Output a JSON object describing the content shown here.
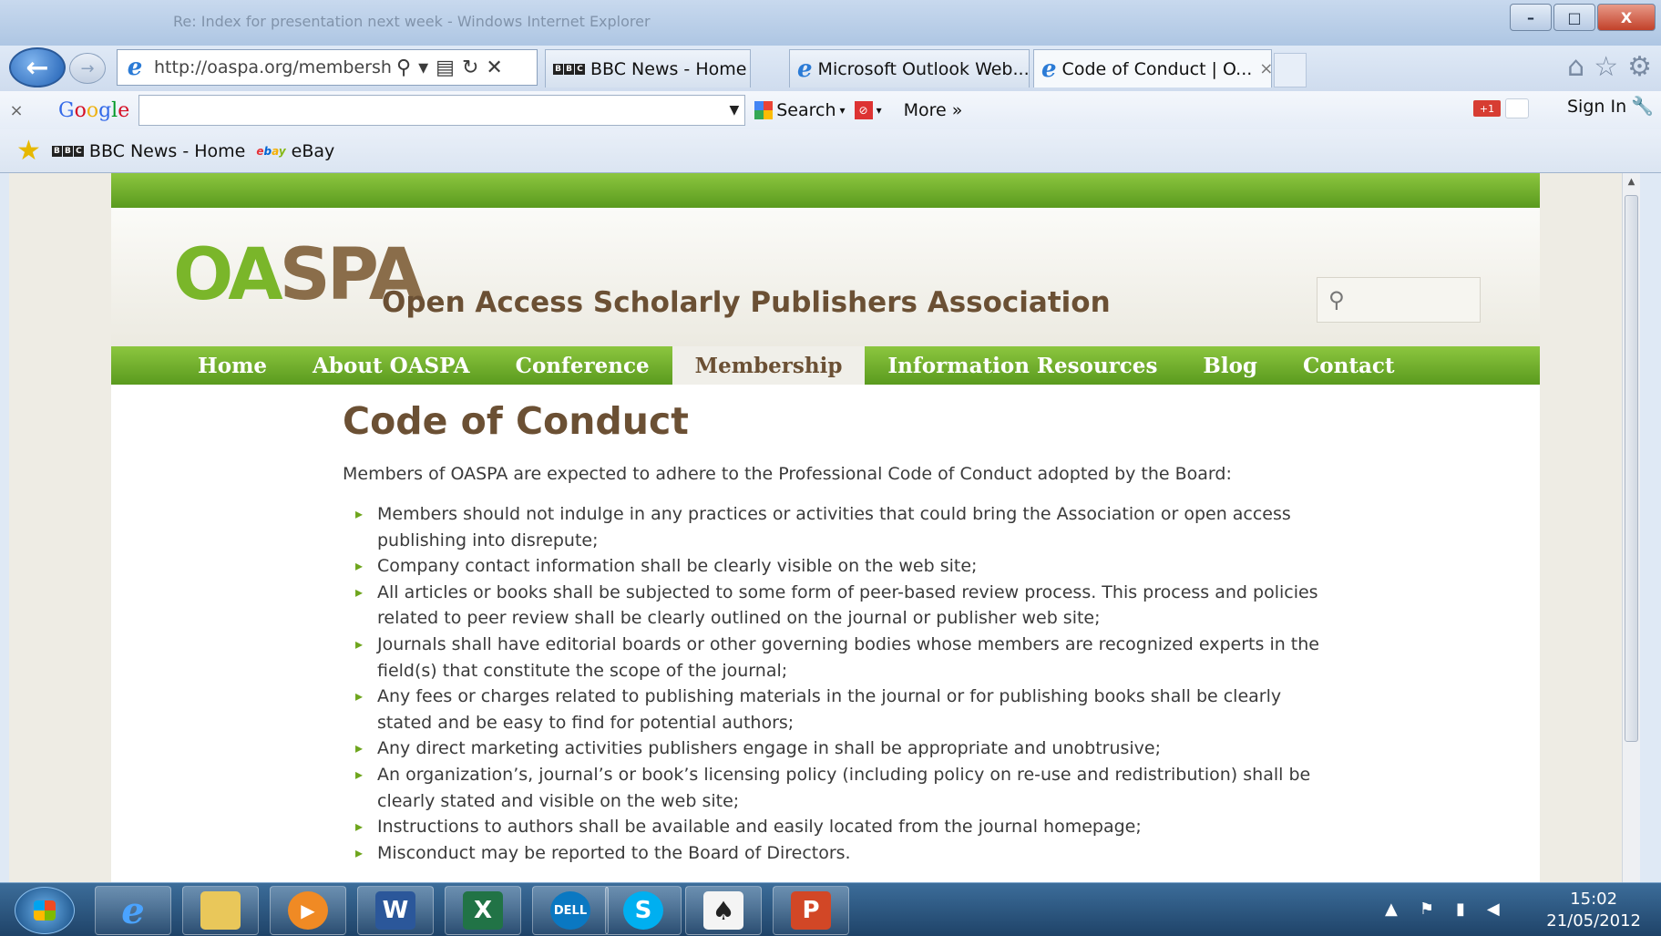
{
  "window": {
    "title": "Re: Index for presentation next week - Windows Internet Explorer",
    "minimize": "–",
    "restore": "□",
    "close": "X"
  },
  "browser": {
    "url": "http://oaspa.org/membershi",
    "tabs": [
      {
        "label": "BBC News - Home",
        "icon": "bbc-icon"
      },
      {
        "label": "Microsoft Outlook Web...",
        "icon": "ie-icon"
      },
      {
        "label": "Code of Conduct | O...",
        "icon": "ie-icon",
        "active": true
      }
    ],
    "tab_close": "×"
  },
  "googlebar": {
    "close": "×",
    "logo_letters": [
      "G",
      "o",
      "o",
      "g",
      "l",
      "e"
    ],
    "search_value": "",
    "search_label": "Search",
    "more_label": "More »",
    "gplus_label": "+1",
    "signin_label": "Sign In"
  },
  "favorites": [
    {
      "label": "BBC News - Home"
    },
    {
      "label": "eBay"
    }
  ],
  "site": {
    "logo": "OASPA",
    "title": "Open Access Scholarly Publishers Association",
    "search_placeholder": "",
    "menu": [
      "Home",
      "About OASPA",
      "Conference",
      "Membership",
      "Information Resources",
      "Blog",
      "Contact"
    ],
    "active_menu": "Membership",
    "page_title": "Code of Conduct",
    "intro": "Members of OASPA are expected to adhere to the Professional Code of Conduct adopted by the Board:",
    "bullets": [
      "Members should not indulge in any practices or activities that could bring the Association or open access publishing into disrepute;",
      "Company contact information shall be clearly visible on the web site;",
      "All articles or books shall be subjected to some form of peer-based review process. This process and policies related to peer review shall be clearly outlined on the journal or publisher web site;",
      "Journals shall have editorial boards or other governing bodies whose members are recognized experts in the field(s) that constitute the scope of the journal;",
      "Any fees or charges related to publishing materials in the journal or for publishing books shall be clearly stated and be easy to find for potential authors;",
      "Any direct marketing activities publishers engage in shall be appropriate and unobtrusive;",
      "An organization’s, journal’s or book’s licensing policy (including policy on re-use and redistribution) shall be clearly stated and visible on the web site;",
      "Instructions to authors shall be available and easily located from the journal homepage;",
      "Misconduct may be reported to the Board of Directors."
    ]
  },
  "taskbar": {
    "apps": [
      "Internet Explorer",
      "Windows Explorer",
      "Media Player",
      "Word",
      "Excel",
      "Dell",
      "Skype",
      "Solitaire",
      "PowerPoint"
    ],
    "time": "15:02",
    "date": "21/05/2012"
  },
  "colors": {
    "green": "#7ab62a",
    "brown": "#6b5034",
    "taskbar": "#1f4368"
  }
}
